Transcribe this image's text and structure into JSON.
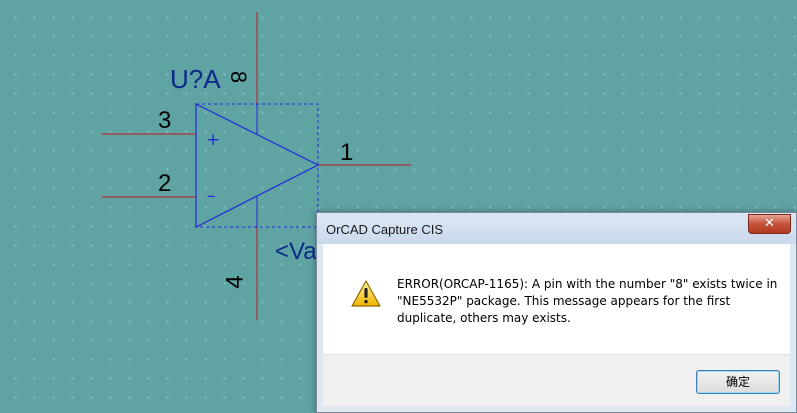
{
  "schematic": {
    "part_reference": "U?A",
    "pin_label_8": "8",
    "pin_labels": {
      "p3": "3",
      "p2": "2",
      "p1": "1",
      "p4": "4"
    },
    "plus_sign": "+",
    "minus_sign": "–",
    "value_label": "<Va",
    "colors": {
      "wire": "#c01818",
      "body": "#1f2bd8",
      "background": "#5fa3a3"
    }
  },
  "dialog": {
    "title": "OrCAD Capture CIS",
    "close_glyph": "✕",
    "message": "ERROR(ORCAP-1165): A pin with the number \"8\" exists twice in \"NE5532P\" package. This message appears for the first duplicate, others may exists.",
    "ok_label": "确定",
    "icon": "warning-icon"
  }
}
